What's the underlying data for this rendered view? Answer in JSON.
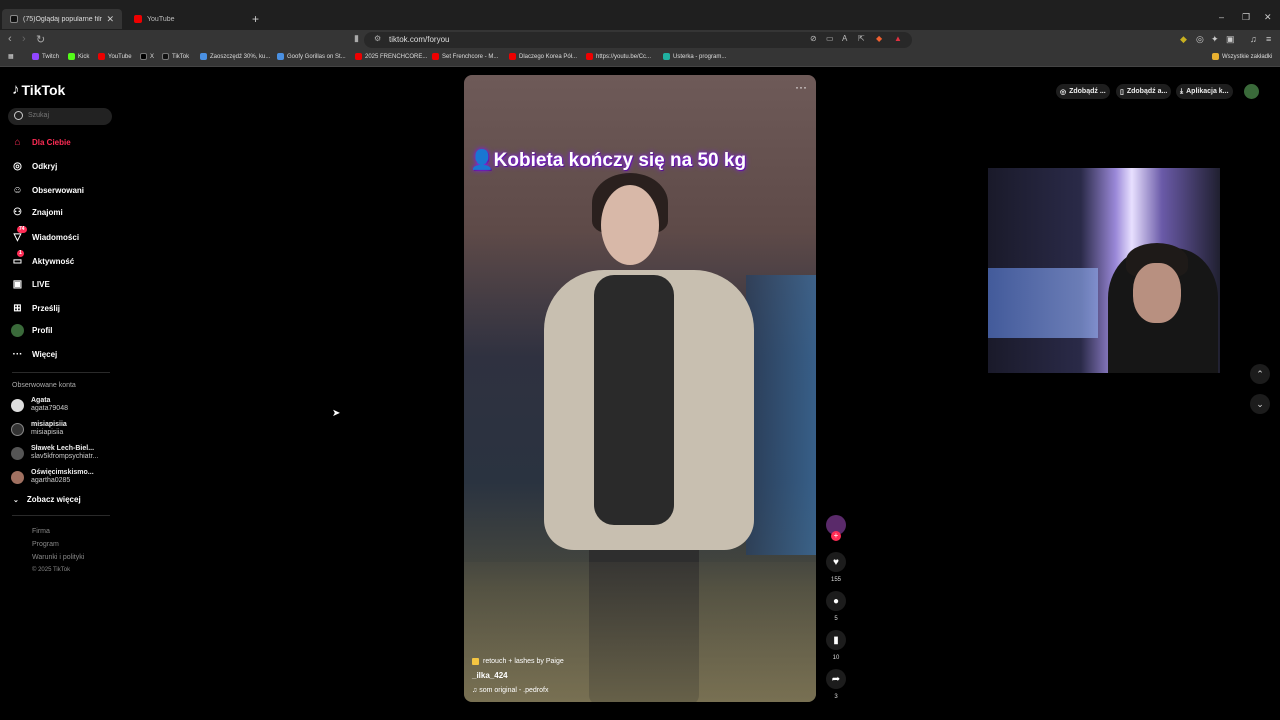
{
  "browser": {
    "tabs": [
      {
        "title": "(75)Oglądaj popularne filmy |",
        "active": true
      },
      {
        "title": "YouTube",
        "active": false
      }
    ],
    "url": "tiktok.com/foryou",
    "bookmarks": [
      "Twitch",
      "Kick",
      "YouTube",
      "X",
      "TikTok",
      "Zaoszczędź 30%, ku...",
      "Goofy Gorillas on St...",
      "2025 FRENCHCORE...",
      "Set Frenchcore - M...",
      "Dlaczego Korea Pół...",
      "https://youtu.be/Cc...",
      "Usterka - program..."
    ],
    "bookmarks_folder": "Wszystkie zakładki"
  },
  "sidebar": {
    "logo": "TikTok",
    "search_placeholder": "Szukaj",
    "menu": [
      {
        "label": "Dla Ciebie",
        "icon": "home-icon",
        "active": true
      },
      {
        "label": "Odkryj",
        "icon": "compass-icon"
      },
      {
        "label": "Obserwowani",
        "icon": "following-icon"
      },
      {
        "label": "Znajomi",
        "icon": "friends-icon"
      },
      {
        "label": "Wiadomości",
        "icon": "messages-icon",
        "badge": "74"
      },
      {
        "label": "Aktywność",
        "icon": "activity-icon",
        "badge": "1"
      },
      {
        "label": "LIVE",
        "icon": "live-icon"
      },
      {
        "label": "Prześlij",
        "icon": "upload-icon"
      },
      {
        "label": "Profil",
        "icon": "profile-icon"
      },
      {
        "label": "Więcej",
        "icon": "more-icon"
      }
    ],
    "followed_title": "Obserwowane konta",
    "followed": [
      {
        "name": "Agata",
        "handle": "agata79048"
      },
      {
        "name": "misiapisiia",
        "handle": "misiapisiia"
      },
      {
        "name": "Sławek Lech-Biel...",
        "handle": "slav5kfrompsychiatr..."
      },
      {
        "name": "Oświęcimskismo...",
        "handle": "agartha0285"
      }
    ],
    "see_more": "Zobacz więcej",
    "footer": [
      "Firma",
      "Program",
      "Warunki i polityki",
      "© 2025 TikTok"
    ]
  },
  "video": {
    "caption_overlay": "Kobieta kończy się na 50 kg",
    "effect": "retouch + lashes by Paige",
    "username": "_ilka_424",
    "sound": "som original - .pedrofx"
  },
  "actions": {
    "likes": "155",
    "comments": "5",
    "saves": "10",
    "shares": "3"
  },
  "top_right": {
    "btn1": "Zdobądź ...",
    "btn2": "Zdobądź a...",
    "btn3": "Aplikacja k..."
  }
}
